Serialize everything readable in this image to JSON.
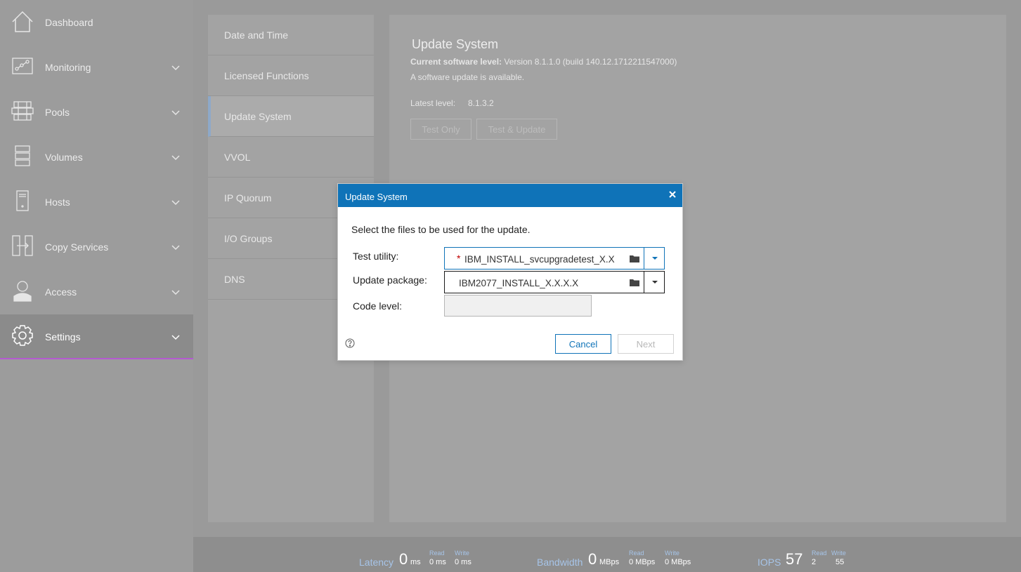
{
  "sidebar": {
    "items": [
      {
        "label": "Dashboard",
        "icon": "home-icon"
      },
      {
        "label": "Monitoring",
        "icon": "monitoring-icon"
      },
      {
        "label": "Pools",
        "icon": "pools-icon"
      },
      {
        "label": "Volumes",
        "icon": "volumes-icon"
      },
      {
        "label": "Hosts",
        "icon": "hosts-icon"
      },
      {
        "label": "Copy Services",
        "icon": "copy-services-icon"
      },
      {
        "label": "Access",
        "icon": "access-icon"
      },
      {
        "label": "Settings",
        "icon": "gear-icon",
        "active": true
      }
    ]
  },
  "settings_nav": {
    "items": [
      {
        "label": "Date and Time"
      },
      {
        "label": "Licensed Functions"
      },
      {
        "label": "Update System",
        "active": true
      },
      {
        "label": "VVOL"
      },
      {
        "label": "IP Quorum"
      },
      {
        "label": "I/O Groups"
      },
      {
        "label": "DNS"
      }
    ]
  },
  "update_panel": {
    "title": "Update System",
    "current_label": "Current software level:",
    "current_value": "Version 8.1.1.0 (build 140.12.1712211547000)",
    "available_text": "A software update is available.",
    "latest_label": "Latest level:",
    "latest_value": "8.1.3.2",
    "test_only_label": "Test Only",
    "test_update_label": "Test & Update"
  },
  "dialog": {
    "title": "Update System",
    "intro": "Select the files to be used for the update.",
    "test_utility_label": "Test utility:",
    "test_utility_value": "IBM_INSTALL_svcupgradetest_X.X",
    "required_mark": "*",
    "update_package_label": "Update package:",
    "update_package_value": "IBM2077_INSTALL_X.X.X.X",
    "code_level_label": "Code level:",
    "code_level_value": "",
    "cancel_label": "Cancel",
    "next_label": "Next"
  },
  "status_bar": {
    "latency": {
      "label": "Latency",
      "value": "0",
      "unit": "ms",
      "read_label": "Read",
      "read_value": "0 ms",
      "write_label": "Write",
      "write_value": "0 ms"
    },
    "bandwidth": {
      "label": "Bandwidth",
      "value": "0",
      "unit": "MBps",
      "read_label": "Read",
      "read_value": "0 MBps",
      "write_label": "Write",
      "write_value": "0 MBps"
    },
    "iops": {
      "label": "IOPS",
      "value": "57",
      "read_label": "Read",
      "read_value": "2",
      "write_label": "Write",
      "write_value": "55"
    }
  },
  "colors": {
    "dialog_header": "#0f73b8",
    "active_nav_underline": "#b45ad0",
    "status_label": "#a6c4e8"
  }
}
